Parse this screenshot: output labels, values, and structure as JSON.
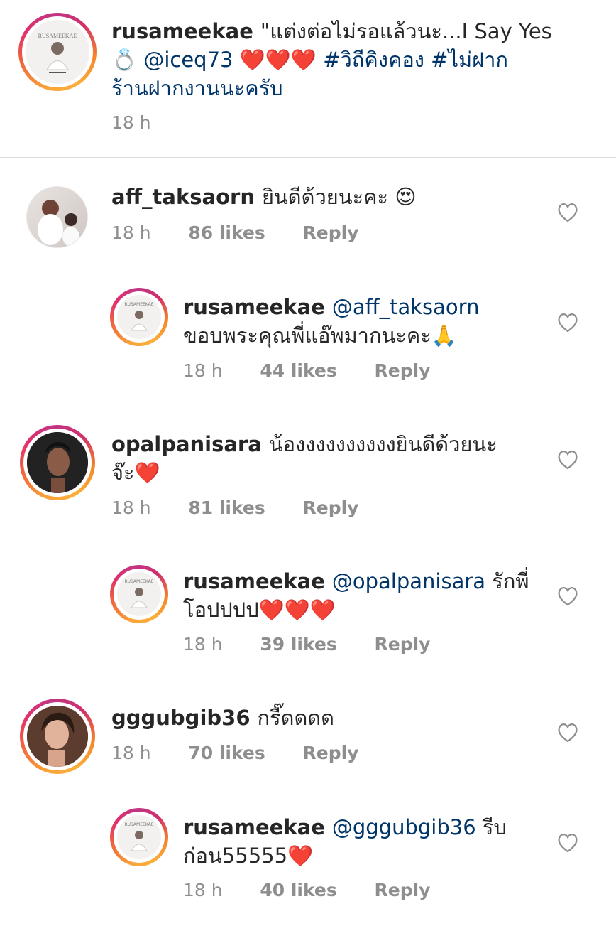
{
  "post": {
    "username": "rusameekae",
    "caption_text": "\"แต่งต่อไม่รอแล้วนะ...I Say Yes",
    "caption_ring": "💍",
    "caption_mention": "@iceq73",
    "caption_hearts": "❤️❤️❤️",
    "caption_tag1": "#วิถีคิงคอง",
    "caption_tag2": "#ไม่ฝาก",
    "caption_line3": "ร้านฝากงานนะครับ",
    "time": "18 h",
    "avatar_text": "RUSAMEEKAE"
  },
  "comments": [
    {
      "username": "aff_taksaorn",
      "text": "ยินดีด้วยนะคะ",
      "emoji": "😍",
      "time": "18 h",
      "likes": "86 likes",
      "reply": "Reply"
    },
    {
      "username": "rusameekae",
      "mention": "@aff_taksaorn",
      "text_line2": "ขอบพระคุณพี่แอ๊พมากนะคะ",
      "emoji": "🙏",
      "time": "18 h",
      "likes": "44 likes",
      "reply": "Reply",
      "avatar_text": "RUSAMEEKAE"
    },
    {
      "username": "opalpanisara",
      "text": "น้องงงงงงงงงงยินดีด้วยนะ",
      "text_line2": "จ๊ะ",
      "emoji": "❤️",
      "time": "18 h",
      "likes": "81 likes",
      "reply": "Reply"
    },
    {
      "username": "rusameekae",
      "mention": "@opalpanisara",
      "text": "รักพี่",
      "text_line2": "โอปปปป",
      "emoji": "❤️❤️❤️",
      "time": "18 h",
      "likes": "39 likes",
      "reply": "Reply",
      "avatar_text": "RUSAMEEKAE"
    },
    {
      "username": "gggubgib36",
      "text": "กรี๊ดดดด",
      "time": "18 h",
      "likes": "70 likes",
      "reply": "Reply"
    },
    {
      "username": "rusameekae",
      "mention": "@gggubgib36",
      "text": "รีบ",
      "text_line2": "ก่อน55555",
      "emoji": "❤️",
      "time": "18 h",
      "likes": "40 likes",
      "reply": "Reply",
      "avatar_text": "RUSAMEEKAE"
    }
  ],
  "icons": {
    "like": "heart-outline-icon"
  },
  "colors": {
    "text": "#262626",
    "meta": "#8e8e8e",
    "link": "#003569",
    "heart_red": "#e0181f"
  }
}
